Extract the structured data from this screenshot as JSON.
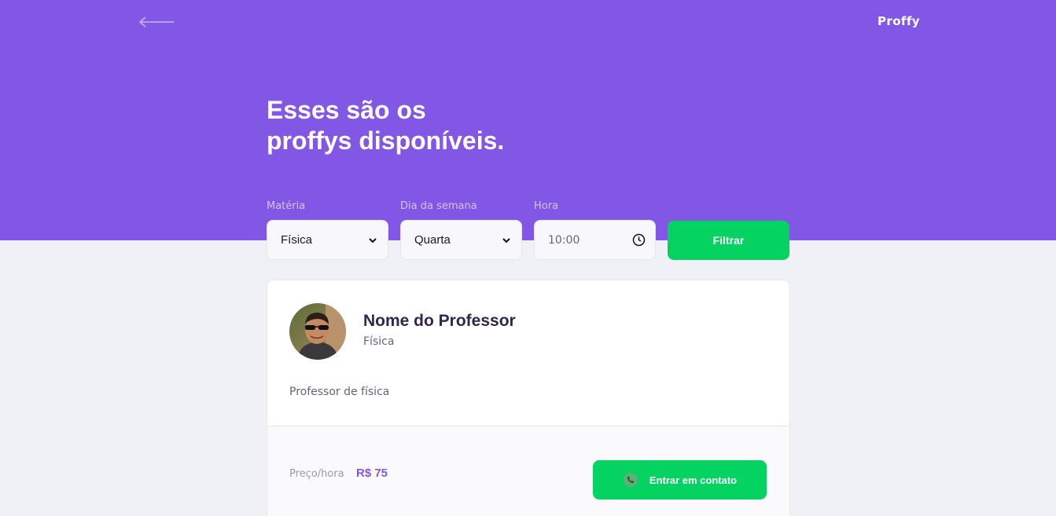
{
  "header": {
    "logo": "Proffy",
    "title_line1": "Esses são os",
    "title_line2": "proffys disponíveis."
  },
  "filters": {
    "subject_label": "Matéria",
    "subject_value": "Física",
    "weekday_label": "Dia da semana",
    "weekday_value": "Quarta",
    "time_label": "Hora",
    "time_value": "10:00",
    "submit_label": "Filtrar"
  },
  "teacher": {
    "name": "Nome do Professor",
    "subject": "Física",
    "bio": "Professor de física",
    "price_label": "Preço/hora",
    "price_value": "R$ 75",
    "contact_label": "Entrar em contato"
  },
  "icons": {
    "back": "arrow-left-icon",
    "select": "chevron-down-icon",
    "time": "clock-icon",
    "contact": "whatsapp-icon"
  },
  "colors": {
    "primary": "#8257E5",
    "background": "#F0F0F7",
    "secondary": "#04D361",
    "title_text": "#32264D",
    "body_text": "#6A6180",
    "label_text": "#D4C2FF"
  }
}
